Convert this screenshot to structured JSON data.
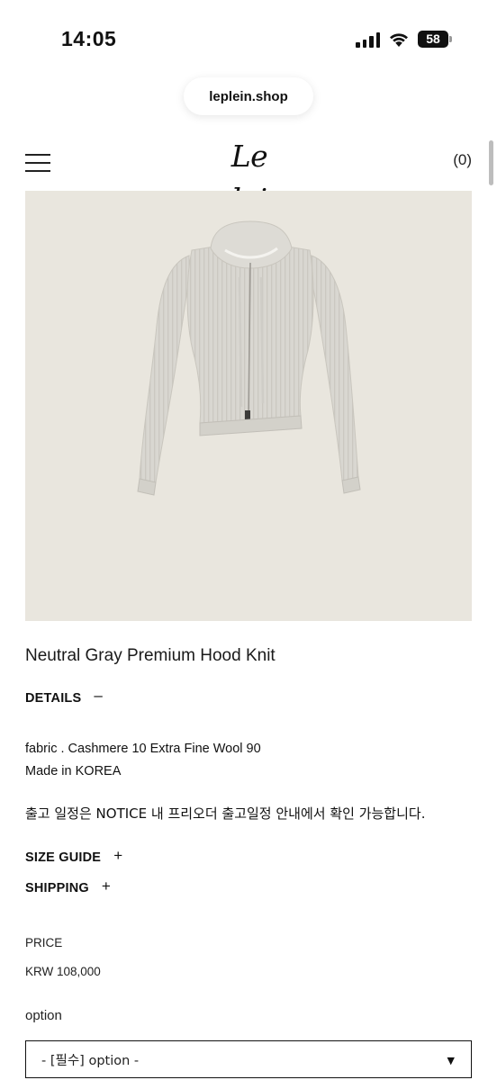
{
  "status_bar": {
    "time": "14:05",
    "battery": "58",
    "icons": [
      "signal-icon",
      "wifi-icon",
      "battery-icon"
    ]
  },
  "browser": {
    "url": "leplein.shop"
  },
  "header": {
    "logo": "Le plein",
    "cart_count": "(0)",
    "menu_icon": "hamburger-menu-icon"
  },
  "product": {
    "image_alt": "hooded zip-up knit cardigan",
    "title": "Neutral Gray Premium Hood Knit",
    "details_label": "DETAILS",
    "details_toggle": "–",
    "details_lines": [
      "fabric . Cashmere 10 Extra Fine Wool 90",
      "Made in KOREA"
    ],
    "notice": "출고 일정은 NOTICE 내 프리오더 출고일정 안내에서 확인 가능합니다.",
    "size_guide_label": "SIZE GUIDE",
    "size_guide_toggle": "+",
    "shipping_label": "SHIPPING",
    "shipping_toggle": "+",
    "price_label": "PRICE",
    "price_value": "KRW 108,000",
    "option_label": "option",
    "option_selected": "- [필수] option -"
  },
  "colors": {
    "image_background": "#e9e6de",
    "garment": "#d9d7d1",
    "text": "#111111"
  }
}
